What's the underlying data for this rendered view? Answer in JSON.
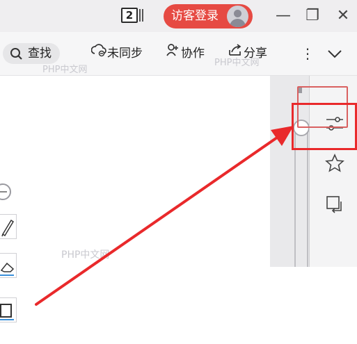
{
  "titlebar": {
    "window_count": "2",
    "login_label": "访客登录",
    "minimize_glyph": "—",
    "restore_glyph": "❐",
    "close_glyph": "✕"
  },
  "toolbar": {
    "search_label": "查找",
    "unsynced_label": "未同步",
    "collab_label": "协作",
    "share_label": "分享",
    "more_glyph": "⋮",
    "collapse_glyph": "∨"
  },
  "watermarks": {
    "a": "PHP中文网",
    "b": "PHP中文网",
    "c": "PHP中文网"
  },
  "right_panel": {
    "icons": [
      "settings-sliders-icon",
      "star-icon",
      "rotate-page-icon"
    ]
  },
  "highlight": {
    "color": "#e9292b"
  }
}
